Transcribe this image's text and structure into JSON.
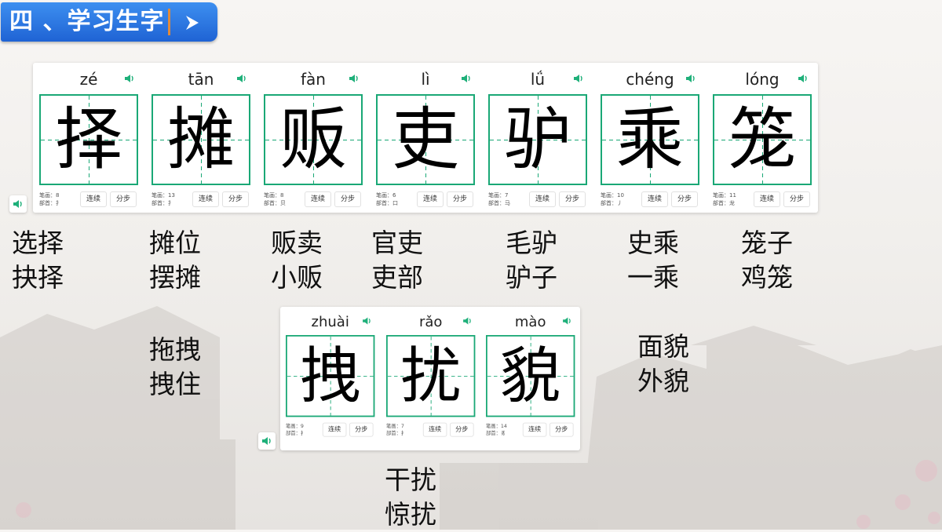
{
  "title": "四 、学习生字",
  "buttons": {
    "continuous": "连续",
    "step": "分步"
  },
  "row1_cards": [
    {
      "pinyin": "zé",
      "char": "择",
      "strokes": "笔画：8",
      "radical": "部首：扌"
    },
    {
      "pinyin": "tān",
      "char": "摊",
      "strokes": "笔画：13",
      "radical": "部首：扌"
    },
    {
      "pinyin": "fàn",
      "char": "贩",
      "strokes": "笔画：8",
      "radical": "部首：贝"
    },
    {
      "pinyin": "lì",
      "char": "吏",
      "strokes": "笔画：6",
      "radical": "部首：口"
    },
    {
      "pinyin": "lǘ",
      "char": "驴",
      "strokes": "笔画：7",
      "radical": "部首：马"
    },
    {
      "pinyin": "chéng",
      "char": "乘",
      "strokes": "笔画：10",
      "radical": "部首：丿"
    },
    {
      "pinyin": "lóng",
      "char": "笼",
      "strokes": "笔画：11",
      "radical": "部首：龙"
    }
  ],
  "row2_cards": [
    {
      "pinyin": "zhuài",
      "char": "拽",
      "strokes": "笔画：9",
      "radical": "部首：扌"
    },
    {
      "pinyin": "rǎo",
      "char": "扰",
      "strokes": "笔画：7",
      "radical": "部首：扌"
    },
    {
      "pinyin": "mào",
      "char": "貌",
      "strokes": "笔画：14",
      "radical": "部首：豸"
    }
  ],
  "words": {
    "ze": [
      "选择",
      "抉择"
    ],
    "tan": [
      "摊位",
      "摆摊"
    ],
    "fan": [
      "贩卖",
      "小贩"
    ],
    "li": [
      "官吏",
      "吏部"
    ],
    "lv": [
      "毛驴",
      "驴子"
    ],
    "cheng": [
      "史乘",
      "一乘"
    ],
    "long": [
      "笼子",
      "鸡笼"
    ],
    "zhuai": [
      "拖拽",
      "拽住"
    ],
    "rao": [
      "干扰",
      "惊扰"
    ],
    "mao": [
      "面貌",
      "外貌"
    ]
  },
  "icons": {
    "speaker": "speaker-icon",
    "arrow": "chevron-right-icon"
  },
  "colors": {
    "banner": "#2f7ae5",
    "grid": "#1aa876",
    "speaker": "#1fb07a"
  }
}
